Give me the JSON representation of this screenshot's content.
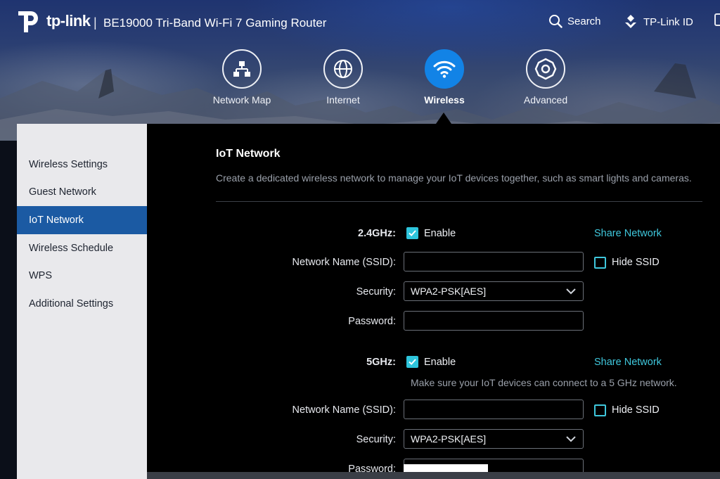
{
  "brand": {
    "logo_text": "tp-link",
    "separator": "|",
    "product_title": "BE19000 Tri-Band Wi-Fi 7 Gaming Router"
  },
  "topbar": {
    "search_label": "Search",
    "account_label": "TP-Link ID"
  },
  "mainnav": [
    {
      "label": "Network Map",
      "icon": "network-map-icon"
    },
    {
      "label": "Internet",
      "icon": "globe-icon"
    },
    {
      "label": "Wireless",
      "icon": "wifi-icon",
      "active": true
    },
    {
      "label": "Advanced",
      "icon": "gear-icon"
    }
  ],
  "sidebar": {
    "items": [
      {
        "label": "Wireless Settings"
      },
      {
        "label": "Guest Network"
      },
      {
        "label": "IoT Network",
        "active": true
      },
      {
        "label": "Wireless Schedule"
      },
      {
        "label": "WPS"
      },
      {
        "label": "Additional Settings"
      }
    ]
  },
  "section": {
    "title": "IoT Network",
    "description": "Create a dedicated wireless network to manage your IoT devices together, such as smart lights and cameras."
  },
  "band24": {
    "label": "2.4GHz:",
    "enable_label": "Enable",
    "enabled": true,
    "share_label": "Share Network",
    "ssid_label": "Network Name (SSID):",
    "ssid_value": "",
    "hide_ssid_label": "Hide SSID",
    "hide_ssid": false,
    "security_label": "Security:",
    "security_value": "WPA2-PSK[AES]",
    "password_label": "Password:",
    "password_value": ""
  },
  "band5": {
    "label": "5GHz:",
    "enable_label": "Enable",
    "enabled": true,
    "share_label": "Share Network",
    "hint": "Make sure your IoT devices can connect to a 5 GHz network.",
    "ssid_label": "Network Name (SSID):",
    "ssid_value": "",
    "hide_ssid_label": "Hide SSID",
    "hide_ssid": false,
    "security_label": "Security:",
    "security_value": "WPA2-PSK[AES]",
    "password_label": "Password:"
  },
  "colors": {
    "accent": "#3fc7dc",
    "active_nav": "#1283e6",
    "sidebar_active": "#1b5aa3"
  }
}
